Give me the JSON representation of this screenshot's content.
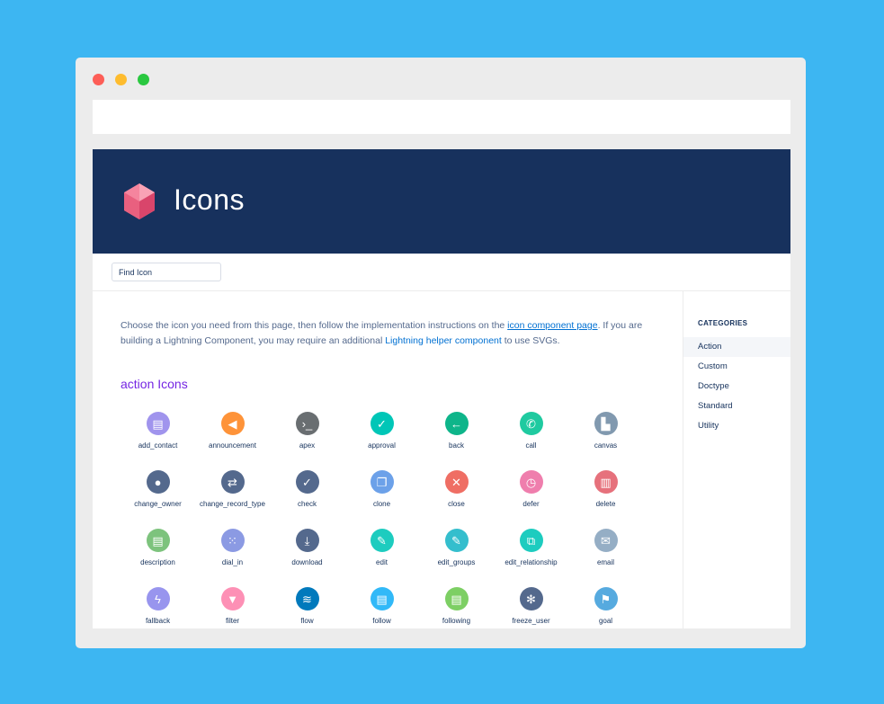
{
  "hero": {
    "title": "Icons"
  },
  "search": {
    "placeholder": "Find Icon"
  },
  "intro": {
    "before": "Choose the icon you need from this page, then follow the implementation instructions on the ",
    "link1": "icon component page",
    "middle": ". If you are building a Lightning Component, you may require an additional ",
    "link2": "Lightning helper component",
    "after": " to use SVGs."
  },
  "section": {
    "title": "action Icons"
  },
  "icons": [
    {
      "label": "add_contact",
      "color": "#a094ed",
      "glyph": "▤"
    },
    {
      "label": "announcement",
      "color": "#fe9339",
      "glyph": "◀"
    },
    {
      "label": "apex",
      "color": "#696e71",
      "glyph": "›_"
    },
    {
      "label": "approval",
      "color": "#00c6b7",
      "glyph": "✓"
    },
    {
      "label": "back",
      "color": "#0eb58a",
      "glyph": "←"
    },
    {
      "label": "call",
      "color": "#1fcaa0",
      "glyph": "✆"
    },
    {
      "label": "canvas",
      "color": "#8199af",
      "glyph": "▙"
    },
    {
      "label": "change_owner",
      "color": "#54698d",
      "glyph": "●"
    },
    {
      "label": "change_record_type",
      "color": "#54698d",
      "glyph": "⇄"
    },
    {
      "label": "check",
      "color": "#54698d",
      "glyph": "✓"
    },
    {
      "label": "clone",
      "color": "#6ca1e9",
      "glyph": "❐"
    },
    {
      "label": "close",
      "color": "#ef6e64",
      "glyph": "✕"
    },
    {
      "label": "defer",
      "color": "#ef7ead",
      "glyph": "◷"
    },
    {
      "label": "delete",
      "color": "#e6717c",
      "glyph": "▥"
    },
    {
      "label": "description",
      "color": "#7dc37d",
      "glyph": "▤"
    },
    {
      "label": "dial_in",
      "color": "#8b9ae3",
      "glyph": "⁙"
    },
    {
      "label": "download",
      "color": "#54698d",
      "glyph": "⤓"
    },
    {
      "label": "edit",
      "color": "#1dccbf",
      "glyph": "✎"
    },
    {
      "label": "edit_groups",
      "color": "#34becd",
      "glyph": "✎"
    },
    {
      "label": "edit_relationship",
      "color": "#1dccbf",
      "glyph": "⧉"
    },
    {
      "label": "email",
      "color": "#95aec5",
      "glyph": "✉"
    },
    {
      "label": "fallback",
      "color": "#9895ee",
      "glyph": "ϟ"
    },
    {
      "label": "filter",
      "color": "#fd90b5",
      "glyph": "▼"
    },
    {
      "label": "flow",
      "color": "#0079bc",
      "glyph": "≋"
    },
    {
      "label": "follow",
      "color": "#31b9f8",
      "glyph": "▤"
    },
    {
      "label": "following",
      "color": "#7dcf64",
      "glyph": "▤"
    },
    {
      "label": "freeze_user",
      "color": "#54698d",
      "glyph": "✻"
    },
    {
      "label": "goal",
      "color": "#56aadf",
      "glyph": "⚑"
    }
  ],
  "sidebar": {
    "title": "CATEGORIES",
    "items": [
      {
        "label": "Action",
        "active": true
      },
      {
        "label": "Custom",
        "active": false
      },
      {
        "label": "Doctype",
        "active": false
      },
      {
        "label": "Standard",
        "active": false
      },
      {
        "label": "Utility",
        "active": false
      }
    ]
  },
  "colors": {
    "background": "#3db6f2",
    "hero": "#17315d",
    "section_title": "#7526e3",
    "link": "#0070d2",
    "logo_light": "#f5859e",
    "logo_dark": "#d9456b"
  }
}
